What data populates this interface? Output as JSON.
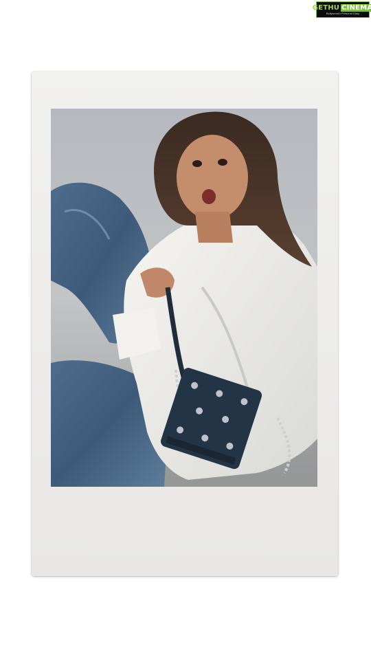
{
  "watermark": {
    "brand_left": "GETHU",
    "brand_right": "CINEMA",
    "tagline": "Bollywood's Personal Diary"
  },
  "photo": {
    "subject": "woman-in-white-shirt-with-monogram-bag",
    "icon": "photo-icon"
  },
  "colors": {
    "page_background": "#ffffff",
    "frame": "#efeeec",
    "watermark_green": "#9dd84a"
  }
}
